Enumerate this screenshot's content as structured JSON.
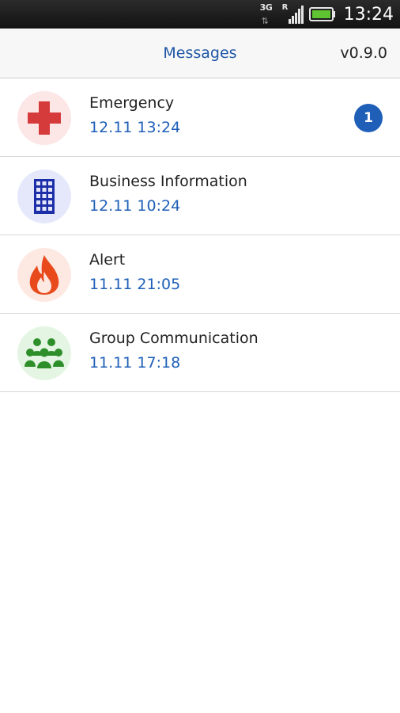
{
  "status_bar": {
    "network": "3G",
    "roaming": "R",
    "time": "13:24"
  },
  "header": {
    "title": "Messages",
    "version": "v0.9.0"
  },
  "colors": {
    "accent": "#1f5fb8",
    "emergency_bg": "#fce6e6",
    "business_bg": "#e5e8fb",
    "alert_bg": "#fde8e2",
    "group_bg": "#e4f6e3"
  },
  "channels": [
    {
      "title": "Emergency",
      "time": "12.11 13:24",
      "icon": "red-cross-icon",
      "unread": "1"
    },
    {
      "title": "Business Information",
      "time": "12.11 10:24",
      "icon": "office-building-icon"
    },
    {
      "title": "Alert",
      "time": "11.11 21:05",
      "icon": "fire-icon"
    },
    {
      "title": "Group Communication",
      "time": "11.11 17:18",
      "icon": "group-people-icon"
    }
  ]
}
